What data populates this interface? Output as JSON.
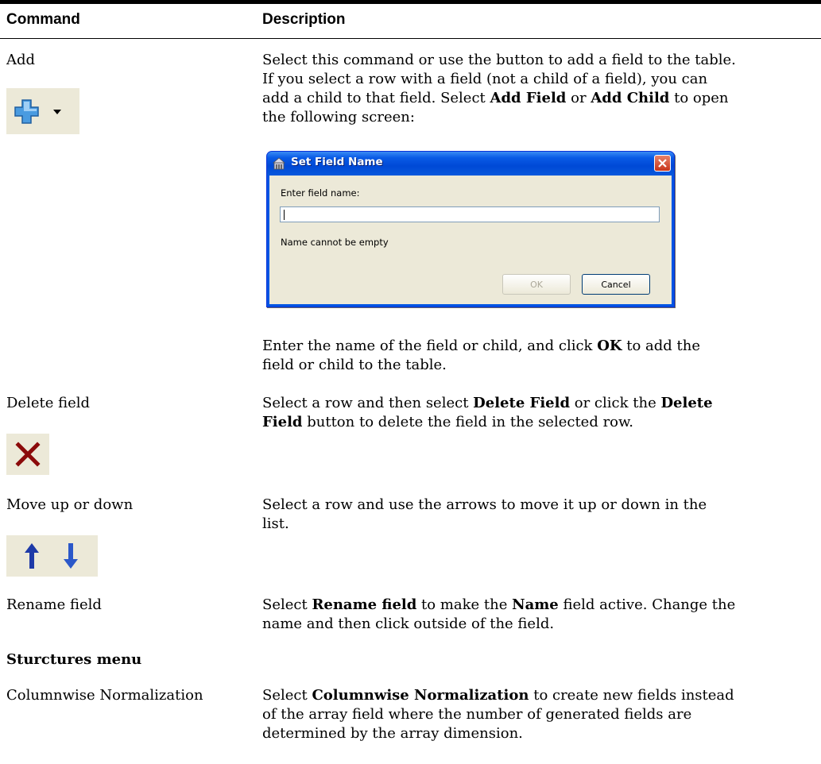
{
  "header": {
    "command": "Command",
    "description": "Description"
  },
  "rows": {
    "add": {
      "command": "Add",
      "desc1": "Select this command or use the button to add a field to the table.",
      "desc2": "If you select a row with a field (not a child of a field), you can",
      "desc3a": "add a child to that field. Select ",
      "desc3b": "Add Field",
      "desc3c": " or ",
      "desc3d": "Add Child",
      "desc3e": " to open",
      "desc4": "the following screen:",
      "after1a": "Enter the name of the field or child, and click ",
      "after1b": "OK",
      "after1c": " to add the",
      "after2": "field or child to the table.",
      "icon": "add-plus-icon"
    },
    "delete": {
      "command": "Delete field",
      "desc1a": "Select a row and then select ",
      "desc1b": "Delete Field",
      "desc1c": " or click the ",
      "desc1d": "Delete",
      "desc2a": "Field",
      "desc2b": " button to delete the field in the selected row.",
      "icon": "delete-x-icon"
    },
    "move": {
      "command": "Move up or down",
      "desc1": "Select a row and use the arrows to move it up or down in the",
      "desc2": "list.",
      "icon_up": "arrow-up-icon",
      "icon_down": "arrow-down-icon"
    },
    "rename": {
      "command": "Rename field",
      "desc1a": "Select ",
      "desc1b": "Rename field",
      "desc1c": " to make the ",
      "desc1d": "Name",
      "desc1e": " field active. Change the",
      "desc2": "name and then click outside of the field."
    },
    "structures": {
      "heading": "Sturctures menu"
    },
    "columnwise": {
      "command": "Columnwise Normalization",
      "desc1a": "Select ",
      "desc1b": "Columnwise Normalization",
      "desc1c": " to create new fields instead",
      "desc2": "of the array field where the number of generated fields are",
      "desc3": "determined by the array dimension."
    }
  },
  "dialog": {
    "title": "Set Field Name",
    "label": "Enter field name:",
    "input_value": "",
    "message": "Name cannot be empty",
    "ok": "OK",
    "cancel": "Cancel"
  },
  "colors": {
    "icon_bg": "#ece9d8",
    "plus": "#3f8fd8",
    "delete": "#8b0000",
    "arrow": "#1e3aa8"
  }
}
